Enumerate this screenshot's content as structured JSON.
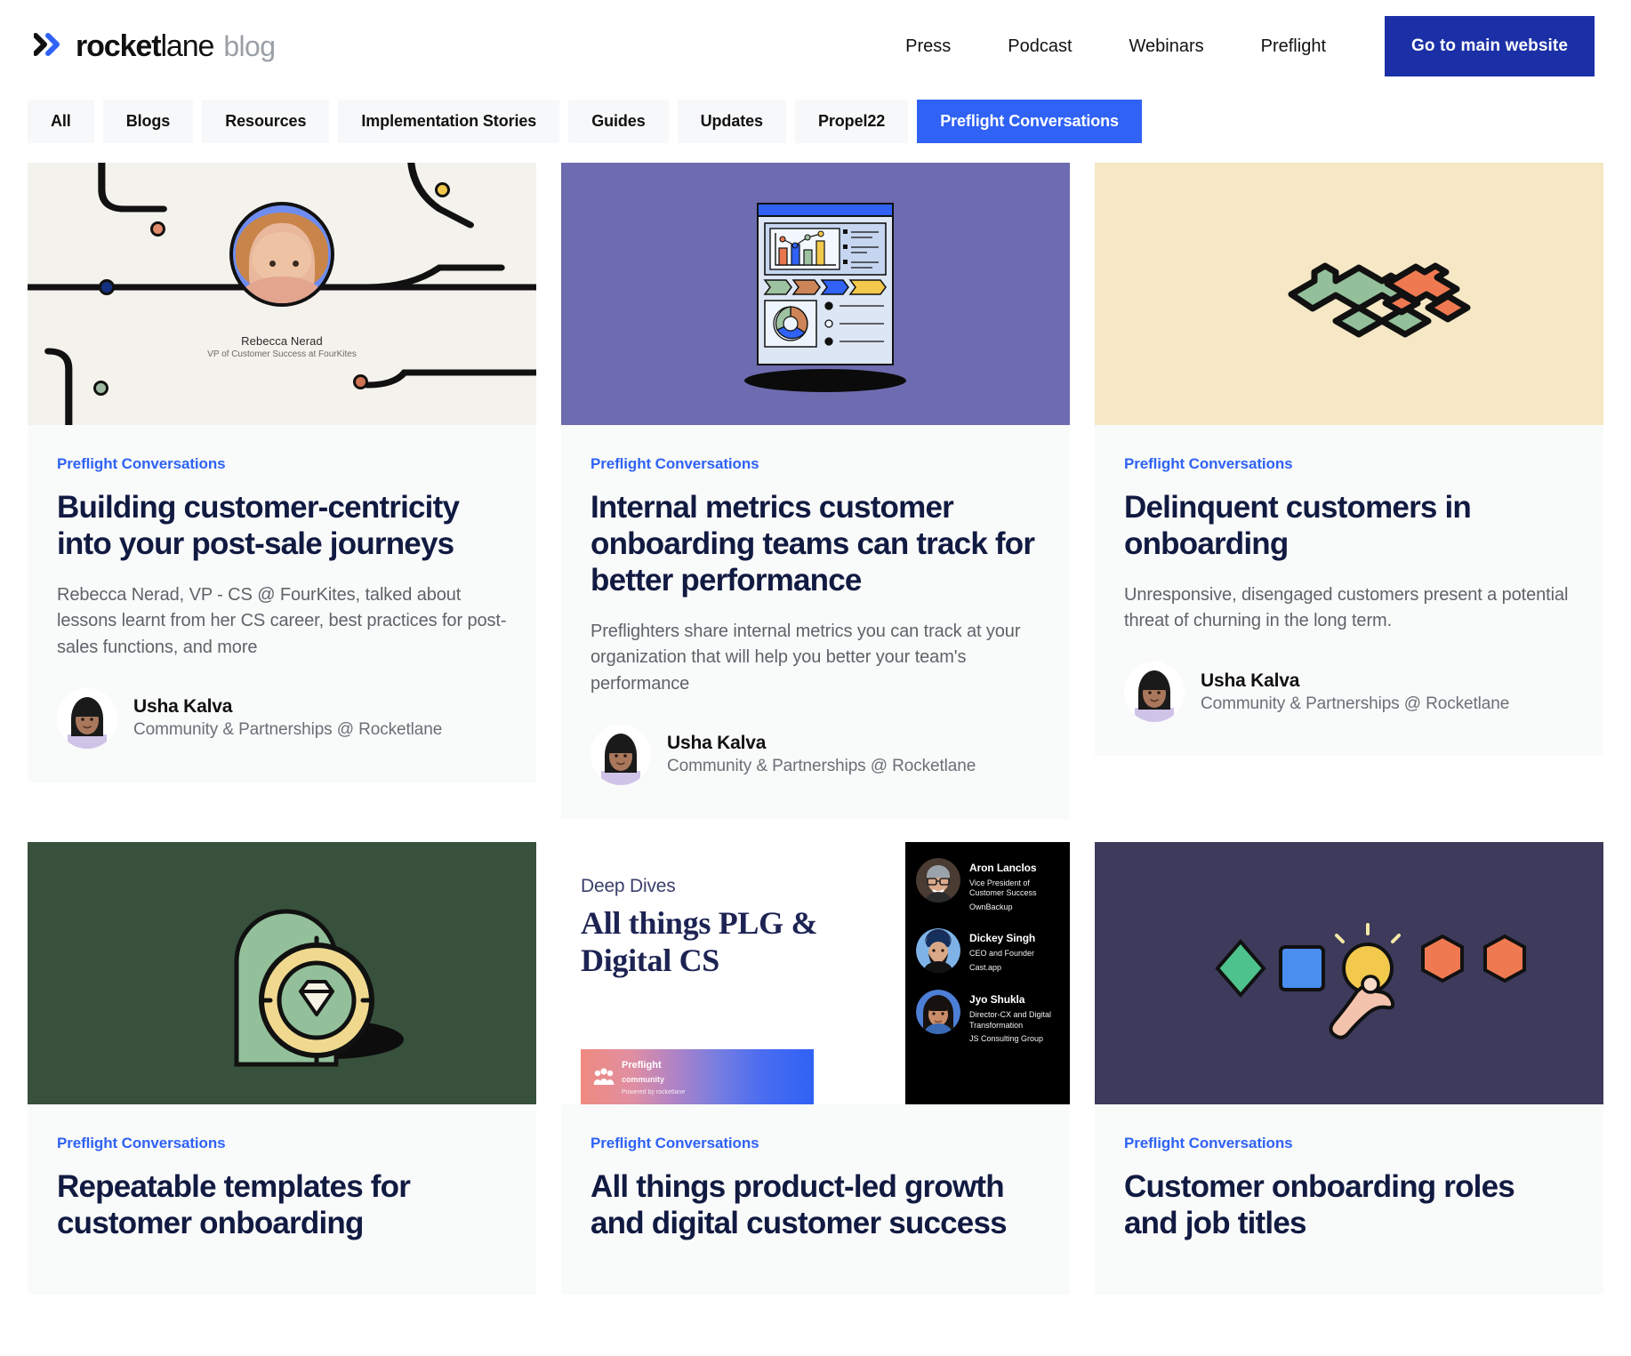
{
  "header": {
    "logo": {
      "mark_icon": "double-chevron-icon",
      "name_bold": "rocket",
      "name_regular": "lane",
      "suffix": "blog"
    },
    "nav": [
      {
        "label": "Press"
      },
      {
        "label": "Podcast"
      },
      {
        "label": "Webinars"
      },
      {
        "label": "Preflight"
      }
    ],
    "cta": {
      "label": "Go to main website",
      "color": "#1b30a6"
    }
  },
  "filters": {
    "active_color": "#2f62f5",
    "items": [
      {
        "label": "All",
        "active": false
      },
      {
        "label": "Blogs",
        "active": false
      },
      {
        "label": "Resources",
        "active": false
      },
      {
        "label": "Implementation Stories",
        "active": false
      },
      {
        "label": "Guides",
        "active": false
      },
      {
        "label": "Updates",
        "active": false
      },
      {
        "label": "Propel22",
        "active": false
      },
      {
        "label": "Preflight Conversations",
        "active": true
      }
    ]
  },
  "cards": [
    {
      "category": "Preflight Conversations",
      "title": "Building customer-centricity into your post-sale journeys",
      "excerpt": "Rebecca Nerad, VP - CS @ FourKites, talked about lessons learnt from her CS career, best practices for post-sales functions, and more",
      "author": {
        "name": "Usha Kalva",
        "role": "Community & Partnerships @ Rocketlane"
      },
      "media": {
        "kind": "journey-map",
        "background": "#f4f2ec",
        "caption_name": "Rebecca Nerad",
        "caption_role": "VP of Customer Success at FourKites"
      }
    },
    {
      "category": "Preflight Conversations",
      "title": "Internal metrics customer onboarding teams can track for better performance",
      "excerpt": "Preflighters share internal metrics you can track at your organization that will help you better your team's performance",
      "author": {
        "name": "Usha Kalva",
        "role": "Community & Partnerships @ Rocketlane"
      },
      "media": {
        "kind": "dashboard-illustration",
        "background": "#6e6cb0"
      }
    },
    {
      "category": "Preflight Conversations",
      "title": "Delinquent customers in onboarding",
      "excerpt": "Unresponsive, disengaged customers present a potential threat of churning in the long term.",
      "author": {
        "name": "Usha Kalva",
        "role": "Community & Partnerships @ Rocketlane"
      },
      "media": {
        "kind": "puzzle-illustration",
        "background": "#f6e7c5"
      }
    },
    {
      "category": "Preflight Conversations",
      "title": "Repeatable templates for customer onboarding",
      "excerpt": "",
      "author": {
        "name": "",
        "role": ""
      },
      "media": {
        "kind": "gem-illustration",
        "background": "#37513c"
      }
    },
    {
      "category": "Preflight Conversations",
      "title": "All things product-led growth and digital customer success",
      "excerpt": "",
      "author": {
        "name": "",
        "role": ""
      },
      "media": {
        "kind": "webinar-promo",
        "background": "#ffffff",
        "kicker": "Deep Dives",
        "headline": "All things PLG & Digital CS",
        "badge": {
          "line1": "Preflight",
          "line2": "community",
          "line3": "Powered by  rocketlane"
        },
        "speakers": [
          {
            "name": "Aron Lanclos",
            "title": "Vice President of Customer Success",
            "org": "OwnBackup"
          },
          {
            "name": "Dickey Singh",
            "title": "CEO and Founder",
            "org": "Cast.app"
          },
          {
            "name": "Jyo Shukla",
            "title": "Director-CX and Digital Transformation",
            "org": "JS Consulting Group"
          }
        ]
      }
    },
    {
      "category": "Preflight Conversations",
      "title": "Customer onboarding roles and job titles",
      "excerpt": "",
      "author": {
        "name": "",
        "role": ""
      },
      "media": {
        "kind": "shapes-illustration",
        "background": "#3d3a5c"
      }
    }
  ]
}
